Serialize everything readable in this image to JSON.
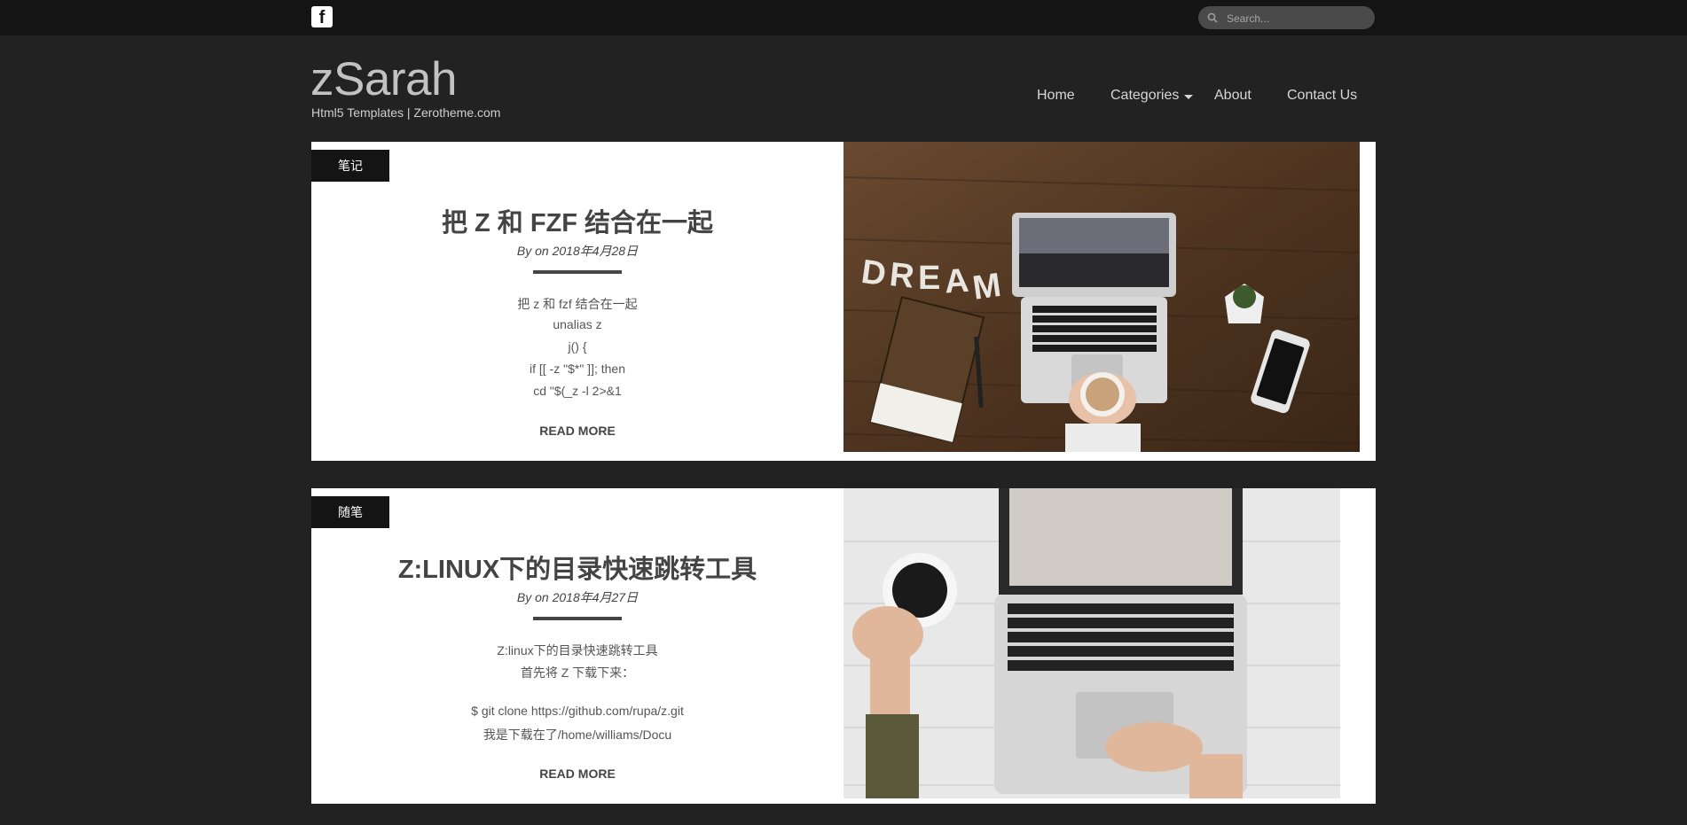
{
  "topbar": {
    "facebook_icon": "facebook-icon",
    "search_placeholder": "Search..."
  },
  "site": {
    "title": "zSarah",
    "tagline": "Html5 Templates | Zerotheme.com"
  },
  "nav": {
    "items": [
      {
        "label": "Home"
      },
      {
        "label": "Categories",
        "has_dropdown": true
      },
      {
        "label": "About"
      },
      {
        "label": "Contact Us"
      }
    ]
  },
  "posts": [
    {
      "category": "笔记",
      "title": "把 Z 和 FZF 结合在一起",
      "meta": "By on 2018年4月28日",
      "excerpt": [
        "把 z 和 fzf 结合在一起",
        "unalias z",
        "j() {",
        "if [[ -z \"$*\" ]]; then",
        "cd \"$(_z -l 2>&1"
      ],
      "read_more": "READ MORE",
      "image": "laptop-dream-desk-photo"
    },
    {
      "category": "随笔",
      "title": "Z:LINUX下的目录快速跳转工具",
      "meta": "By on 2018年4月27日",
      "excerpt": [
        "Z:linux下的目录快速跳转工具",
        "首先将 Z 下载下来：",
        "",
        "$ git clone https://github.com/rupa/z.git",
        "我是下载在了/home/williams/Docu"
      ],
      "read_more": "READ MORE",
      "image": "laptop-coffee-hands-photo"
    }
  ],
  "colors": {
    "page_bg": "#222222",
    "topbar_bg": "#141414",
    "card_bg": "#ffffff",
    "accent_dark": "#141414"
  }
}
